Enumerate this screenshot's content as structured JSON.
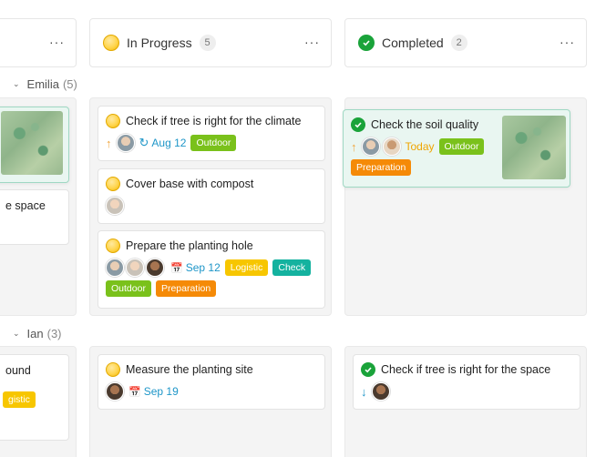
{
  "columns": [
    {
      "key": "left",
      "title": "",
      "count": ""
    },
    {
      "key": "in_progress",
      "title": "In Progress",
      "count": "5"
    },
    {
      "key": "completed",
      "title": "Completed",
      "count": "2"
    }
  ],
  "more_label": "···",
  "groups": [
    {
      "name": "Emilia",
      "count": "(5)"
    },
    {
      "name": "Ian",
      "count": "(3)"
    }
  ],
  "emilia": {
    "left_card": {
      "title_fragment": "e space"
    },
    "in_progress": [
      {
        "title": "Check if tree is right for the climate",
        "date": "Aug 12",
        "tags": [
          "Outdoor"
        ]
      },
      {
        "title": "Cover base with compost"
      },
      {
        "title": "Prepare the planting hole",
        "date": "Sep 12",
        "tags": [
          "Logistic",
          "Check",
          "Outdoor",
          "Preparation"
        ]
      }
    ],
    "completed": [
      {
        "title": "Check the soil quality",
        "date": "Today",
        "tags": [
          "Outdoor",
          "Preparation"
        ]
      }
    ]
  },
  "ian": {
    "left_card": {
      "title_fragment": "ound",
      "tag": "gistic"
    },
    "in_progress": [
      {
        "title": "Measure the planting site",
        "date": "Sep 19"
      }
    ],
    "completed": [
      {
        "title": "Check if tree is right for the space"
      }
    ]
  },
  "colors": {
    "outdoor": "#7ac11b",
    "preparation": "#f58a07",
    "logistic": "#f7c600",
    "check": "#14b29f",
    "date": "#1e96c8",
    "today": "#f0a500",
    "done": "#1aa33a"
  },
  "icons": {
    "in_progress": "in-progress-circle-icon",
    "completed": "check-circle-icon",
    "priority_up": "arrow-up-icon",
    "priority_down": "arrow-down-icon",
    "recurring": "recurring-icon",
    "calendar": "calendar-icon"
  }
}
